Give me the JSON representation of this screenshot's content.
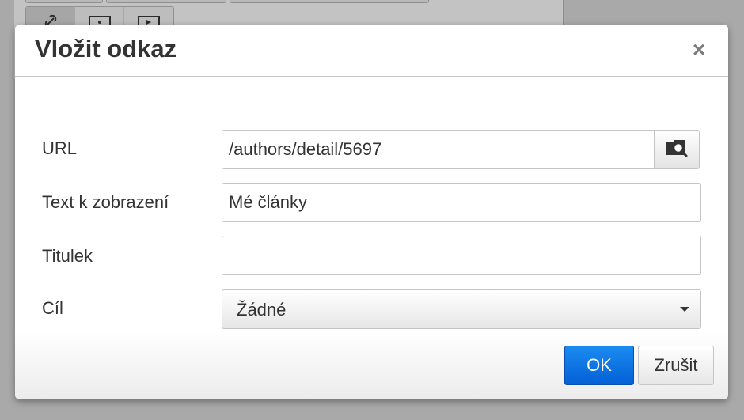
{
  "dialog": {
    "title": "Vložit odkaz",
    "close_symbol": "×"
  },
  "form": {
    "url": {
      "label": "URL",
      "value": "/authors/detail/5697",
      "browse_icon": "browse-folder-icon"
    },
    "text": {
      "label": "Text k zobrazení",
      "value": "Mé články"
    },
    "title": {
      "label": "Titulek",
      "value": ""
    },
    "target": {
      "label": "Cíl",
      "selected": "Žádné"
    }
  },
  "footer": {
    "ok_label": "OK",
    "cancel_label": "Zrušit"
  },
  "colors": {
    "primary": "#0a6fe0",
    "overlay": "#a9a9a9"
  }
}
